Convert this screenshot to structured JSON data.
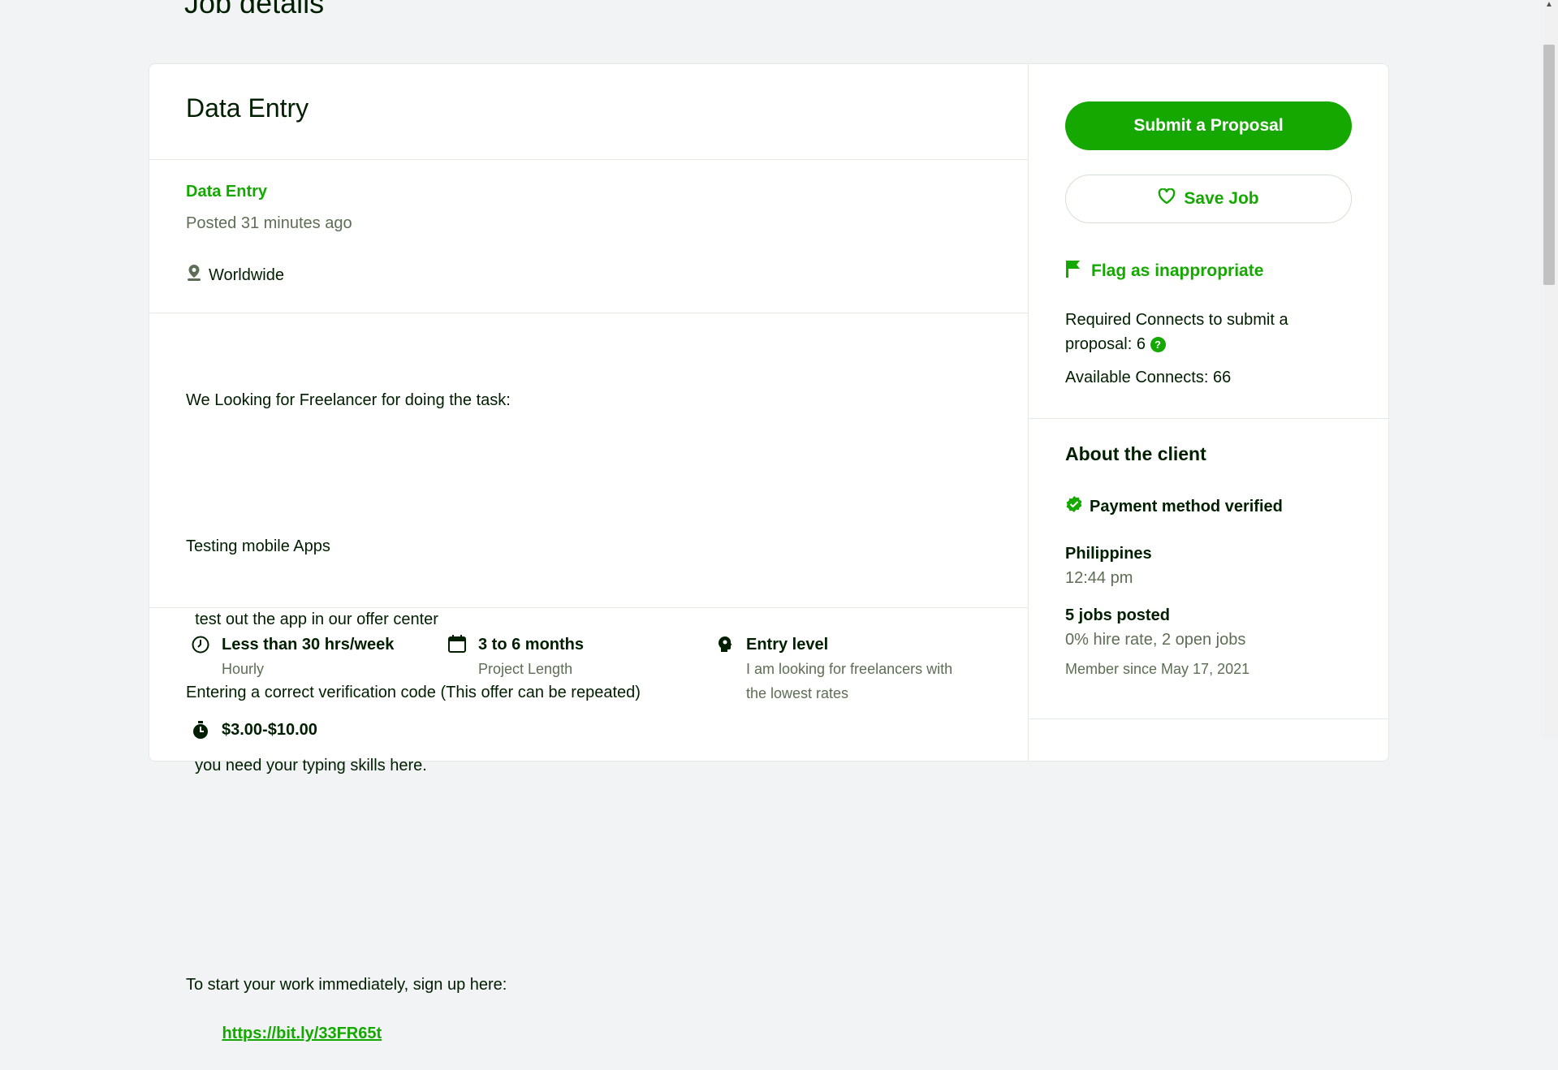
{
  "page": {
    "title": "Job details"
  },
  "job": {
    "title": "Data Entry",
    "category": "Data Entry",
    "posted": "Posted 31 minutes ago",
    "location": "Worldwide",
    "description_lines": [
      "We Looking for Freelancer for doing the task:",
      "",
      "Testing mobile Apps",
      "  test out the app in our offer center",
      "Entering a correct verification code (This offer can be repeated)",
      "  you need your typing skills here.",
      "",
      "",
      "To start your work immediately, sign up here:"
    ],
    "link": "https://bit.ly/33FR65t",
    "features": [
      {
        "icon": "clock-icon",
        "title": "Less than 30 hrs/week",
        "sub": "Hourly"
      },
      {
        "icon": "calendar-icon",
        "title": "3 to 6 months",
        "sub": "Project Length",
        "badge": "3-6"
      },
      {
        "icon": "expertise-icon",
        "title": "Entry level",
        "sub": "I am looking for freelancers with the lowest rates"
      },
      {
        "icon": "stopwatch-icon",
        "title": "$3.00-$10.00",
        "sub": ""
      }
    ]
  },
  "sidebar": {
    "submit_label": "Submit a Proposal",
    "save_label": "Save Job",
    "flag_label": "Flag as inappropriate",
    "connects_required": "Required Connects to submit a proposal: 6",
    "connects_available": "Available Connects: 66"
  },
  "client": {
    "heading": "About the client",
    "payment": "Payment method verified",
    "country": "Philippines",
    "time": "12:44 pm",
    "jobs_posted": "5 jobs posted",
    "hire_rate": "0% hire rate, 2 open jobs",
    "member_since": "Member since May 17, 2021"
  },
  "colors": {
    "accent": "#14a800",
    "text": "#001e00",
    "muted": "#5e6d55",
    "background": "#f2f3f4"
  }
}
